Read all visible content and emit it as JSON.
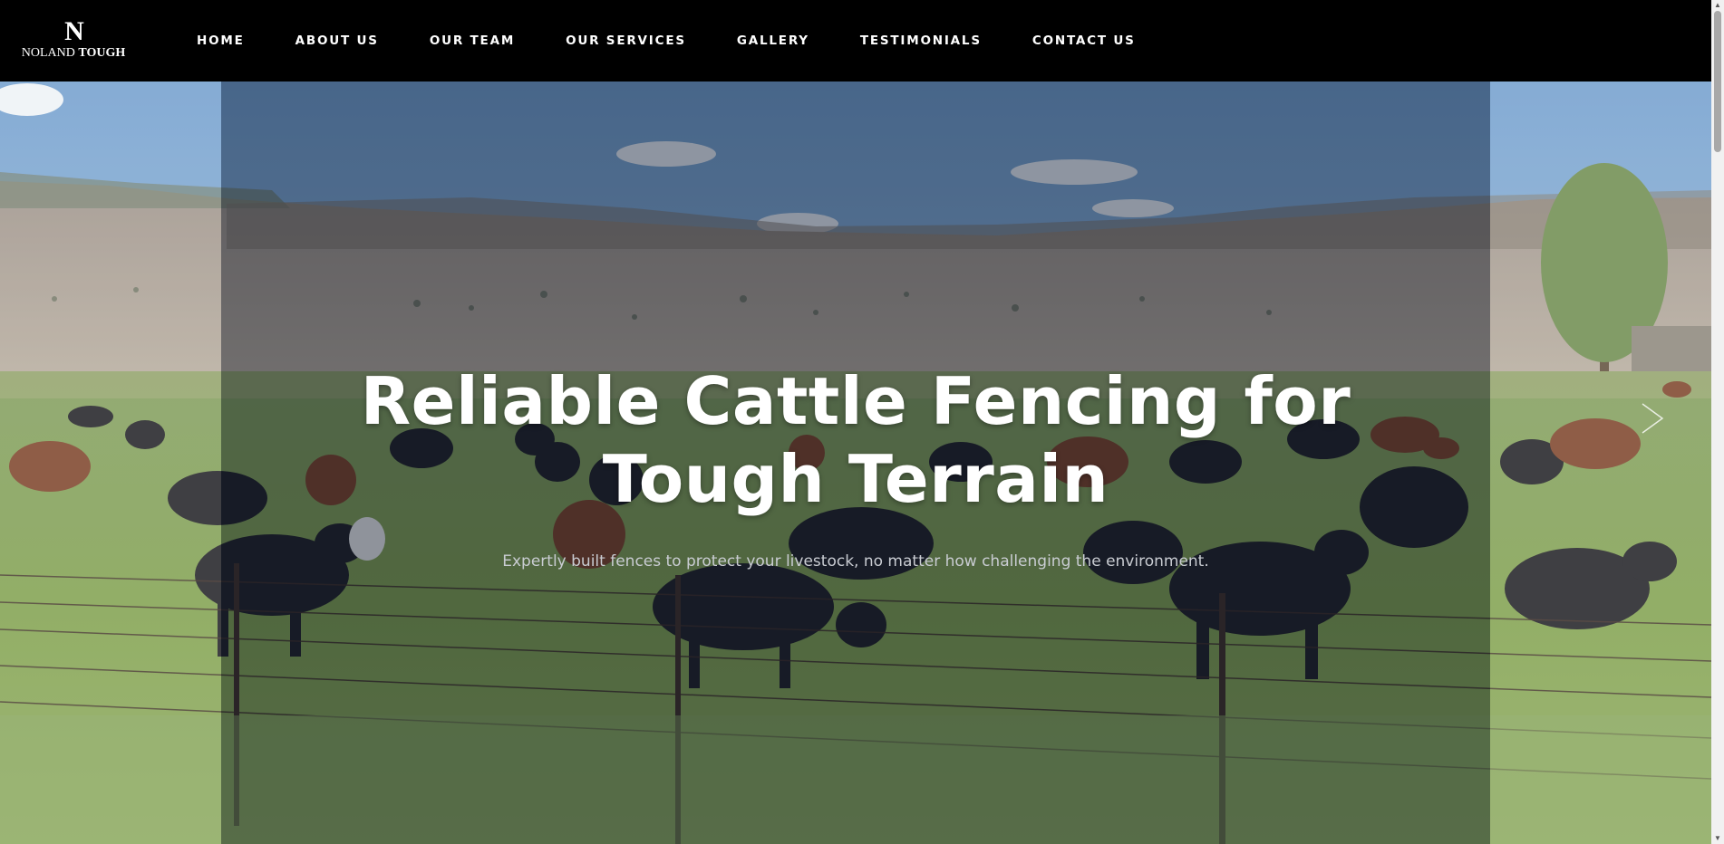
{
  "brand": {
    "logo_mark": "N",
    "name_part1": "NOLAND",
    "name_part2": "TOUGH"
  },
  "nav": {
    "items": [
      {
        "label": "HOME"
      },
      {
        "label": "ABOUT US"
      },
      {
        "label": "OUR TEAM"
      },
      {
        "label": "OUR SERVICES"
      },
      {
        "label": "GALLERY"
      },
      {
        "label": "TESTIMONIALS"
      },
      {
        "label": "CONTACT US"
      }
    ]
  },
  "hero": {
    "title_line1": "Reliable Cattle Fencing for",
    "title_line2": "Tough Terrain",
    "subtitle": "Expertly built fences to protect your livestock, no matter how challenging the environment.",
    "background_description_icon": "cattle-pasture-image",
    "next_icon": "chevron-right-icon",
    "prev_icon": "chevron-left-icon"
  },
  "colors": {
    "header_bg": "#000000",
    "text": "#ffffff",
    "overlay": "#121c30"
  }
}
